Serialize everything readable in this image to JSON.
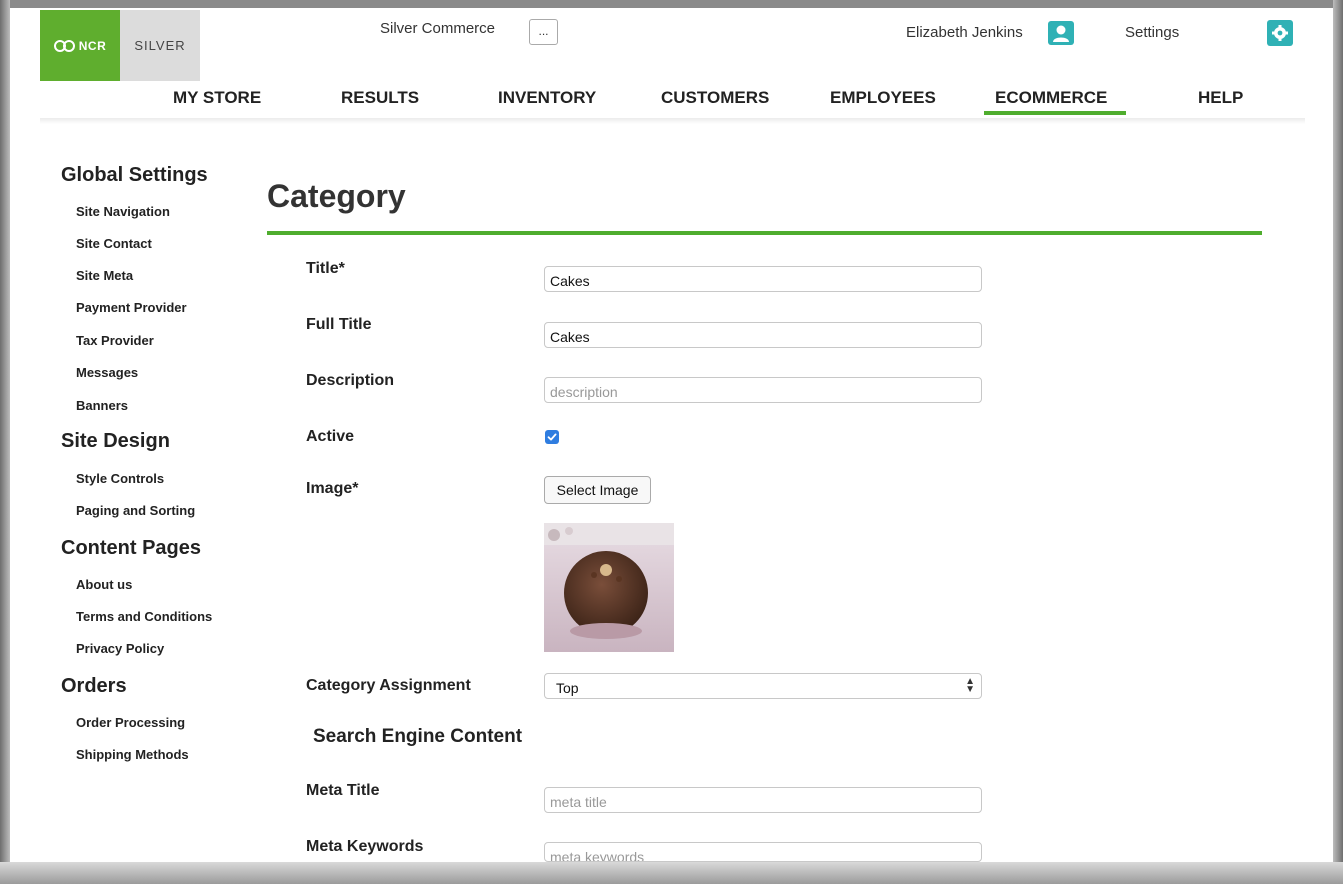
{
  "header": {
    "logo_ncr": "NCR",
    "logo_silver": "SILVER",
    "app_title": "Silver Commerce",
    "more_button": "...",
    "user_name": "Elizabeth Jenkins",
    "settings_label": "Settings"
  },
  "nav": {
    "items": [
      "MY STORE",
      "RESULTS",
      "INVENTORY",
      "CUSTOMERS",
      "EMPLOYEES",
      "ECOMMERCE",
      "HELP"
    ],
    "active": "ECOMMERCE",
    "accent_color": "#4fad2e"
  },
  "sidebar": {
    "global_settings": "Global Settings",
    "site_navigation": "Site Navigation",
    "site_contact": "Site Contact",
    "site_meta": "Site Meta",
    "payment_provider": "Payment Provider",
    "tax_provider": "Tax Provider",
    "messages": "Messages",
    "banners": "Banners",
    "site_design": "Site Design",
    "style_controls": "Style Controls",
    "paging_and_sorting": "Paging and Sorting",
    "content_pages": "Content Pages",
    "about_us": "About us",
    "terms_and_conditions": "Terms and Conditions",
    "privacy_policy": "Privacy Policy",
    "orders": "Orders",
    "order_processing": "Order Processing",
    "shipping_methods": "Shipping Methods"
  },
  "main": {
    "page_title": "Category",
    "form": {
      "title_label": "Title*",
      "title_value": "Cakes",
      "full_title_label": "Full Title",
      "full_title_value": "Cakes",
      "description_label": "Description",
      "description_placeholder": "description",
      "active_label": "Active",
      "active_checked": true,
      "image_label": "Image*",
      "select_image_button": "Select Image",
      "category_assignment_label": "Category Assignment",
      "category_assignment_value": "Top",
      "search_engine_heading": "Search Engine Content",
      "meta_title_label": "Meta Title",
      "meta_title_placeholder": "meta title",
      "meta_keywords_label": "Meta Keywords",
      "meta_keywords_placeholder": "meta keywords"
    }
  }
}
